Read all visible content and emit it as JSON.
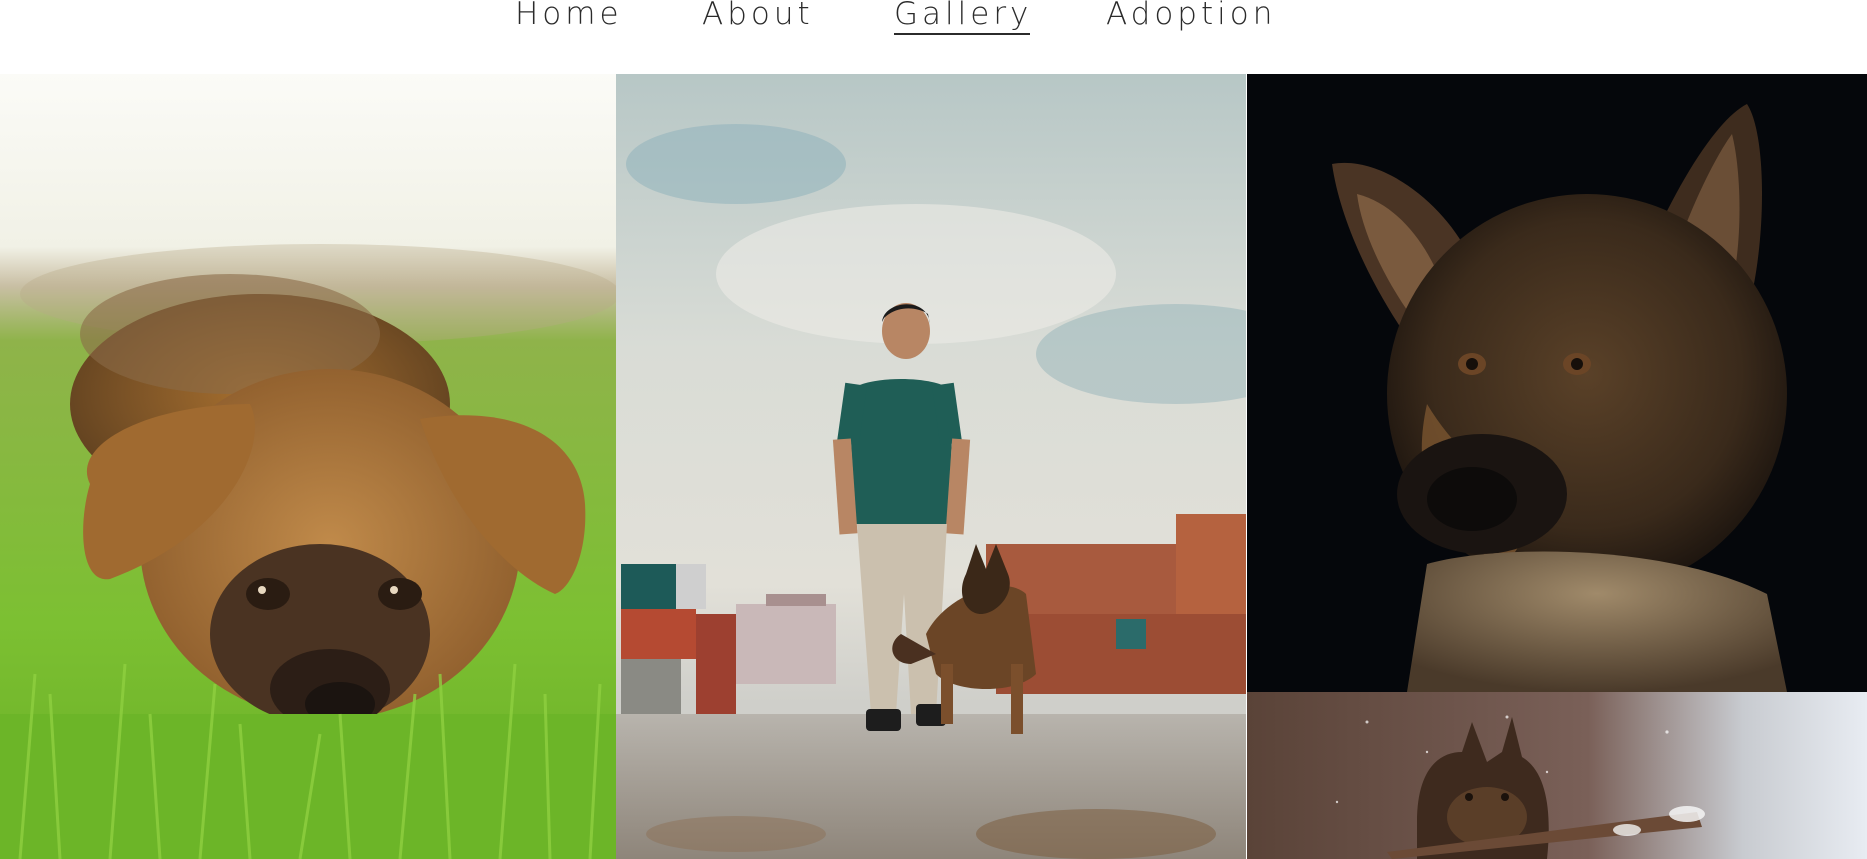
{
  "nav": {
    "home": "Home",
    "about": "About",
    "gallery": "Gallery",
    "adoption": "Adoption",
    "active": "gallery"
  },
  "gallery": {
    "tiles": [
      "german-shepherd-puppy-lying-in-grass",
      "man-walking-with-german-shepherd",
      "german-shepherd-portrait-dark-background",
      "german-shepherd-carrying-stick-in-snow"
    ]
  }
}
